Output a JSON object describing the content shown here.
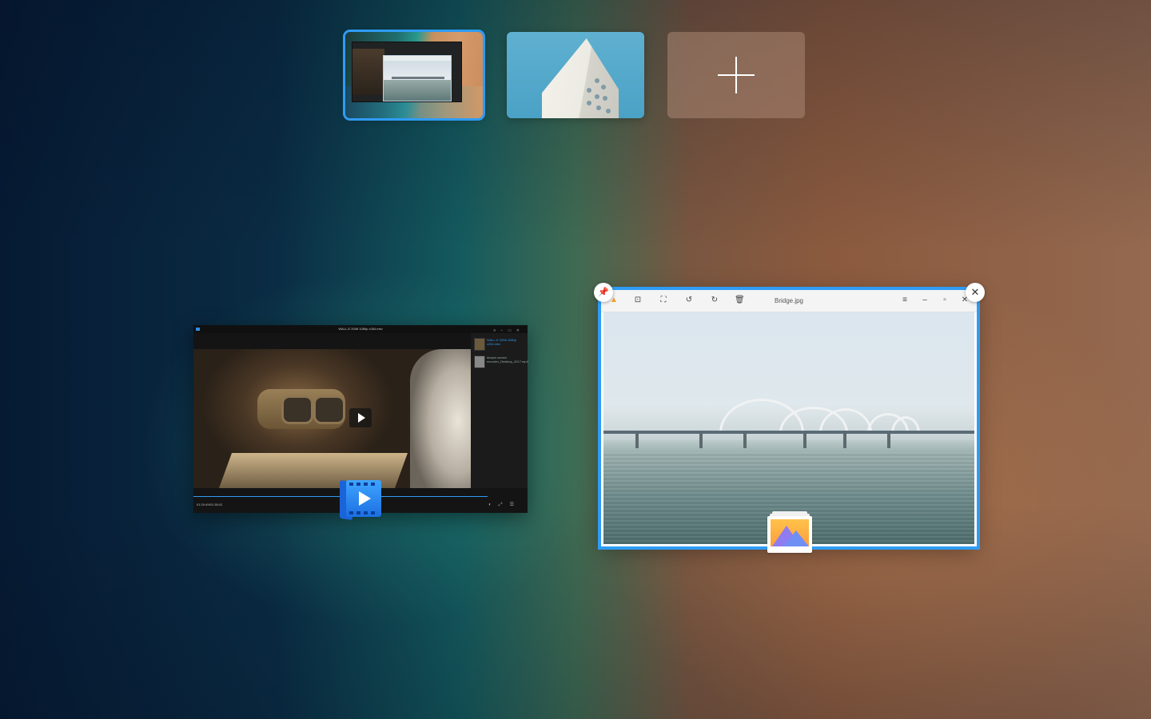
{
  "workspaces": {
    "items": [
      {
        "name": "workspace-1",
        "active": true
      },
      {
        "name": "workspace-2",
        "active": false
      }
    ],
    "add_icon": "plus-icon"
  },
  "movie_window": {
    "title": "WALL-E 2008 1080p x264.mkv",
    "playlist": [
      {
        "title": "WALL-E 2008 1080p x264.mkv",
        "active": true
      },
      {
        "title": "deepin screen recorder_Desktop_2017.mp4",
        "active": false
      }
    ],
    "time": "01:20:49/01:38:42",
    "app_icon": "movie-app-icon",
    "accent": "#2f9cf5"
  },
  "image_window": {
    "title": "Bridge.jpg",
    "toolbar_icons": [
      "image-viewer-logo-icon",
      "fit-window-icon",
      "fullscreen-icon",
      "rotate-left-icon",
      "rotate-right-icon",
      "delete-icon"
    ],
    "window_icons": [
      "menu-icon",
      "minimize-icon",
      "maximize-icon",
      "close-icon"
    ],
    "app_icon": "image-viewer-app-icon",
    "pin_icon": "pin-icon",
    "close_icon": "close-icon",
    "accent": "#2f9cf5"
  }
}
